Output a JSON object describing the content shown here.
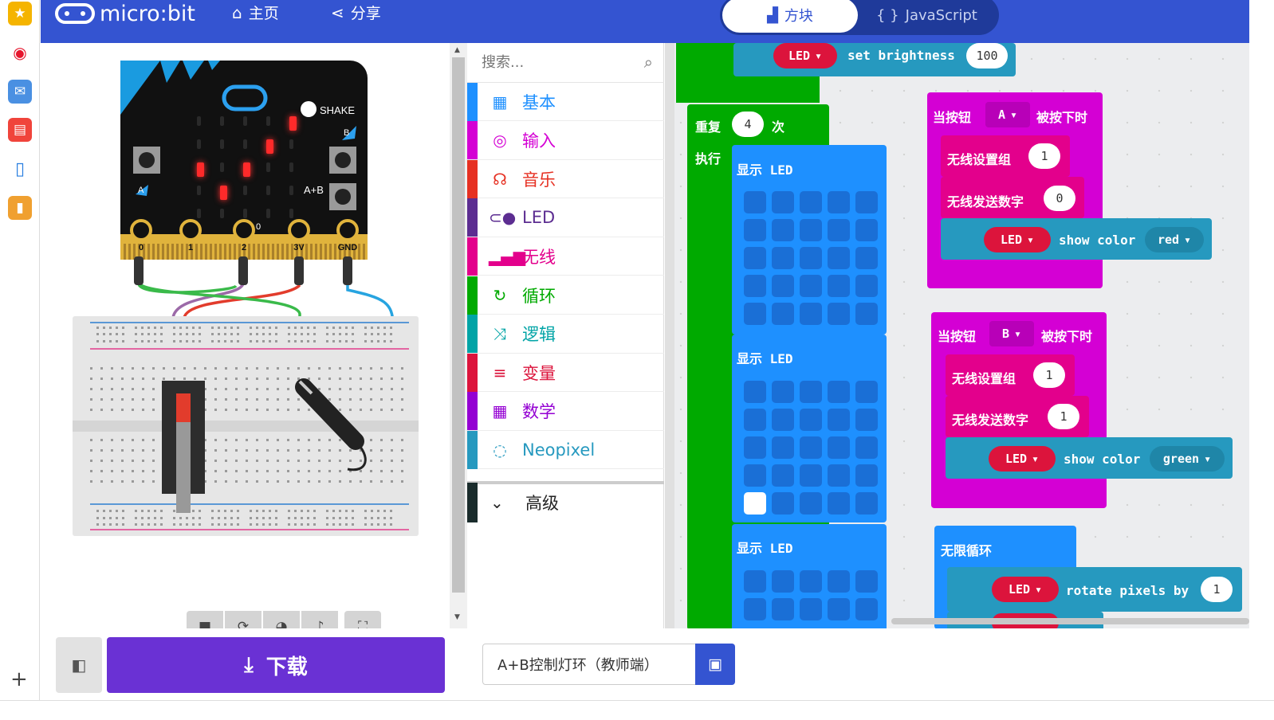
{
  "header": {
    "logo_text": "micro:bit",
    "home_label": "主页",
    "share_label": "分享",
    "mode_blocks_label": "方块",
    "mode_js_label": "JavaScript"
  },
  "simulator": {
    "board": {
      "shake_label": "SHAKE",
      "button_b_label": "B",
      "button_a_label": "A",
      "ab_label": "A+B",
      "pin_labels": [
        "0",
        "1",
        "2",
        "3V",
        "GND"
      ],
      "pin0_side_label": "0",
      "led_on": [
        [
          0,
          4,
          0
        ],
        [
          1,
          3,
          0
        ],
        [
          2,
          0,
          0
        ],
        [
          2,
          2,
          0
        ],
        [
          3,
          1,
          0
        ]
      ]
    }
  },
  "toolbox": {
    "search_placeholder": "搜索...",
    "categories": [
      {
        "label": "基本",
        "color": "#1e90ff",
        "icon": "grid-icon"
      },
      {
        "label": "输入",
        "color": "#d400d4",
        "icon": "target-icon"
      },
      {
        "label": "音乐",
        "color": "#e63022",
        "icon": "headphones-icon"
      },
      {
        "label": "LED",
        "color": "#5c2d91",
        "icon": "toggle-icon"
      },
      {
        "label": "无线",
        "color": "#e3008c",
        "icon": "signal-icon"
      },
      {
        "label": "循环",
        "color": "#00aa00",
        "icon": "loop-icon"
      },
      {
        "label": "逻辑",
        "color": "#00a4a6",
        "icon": "shuffle-icon"
      },
      {
        "label": "变量",
        "color": "#dc143c",
        "icon": "lines-icon"
      },
      {
        "label": "数学",
        "color": "#9400d3",
        "icon": "calculator-icon"
      },
      {
        "label": "Neopixel",
        "color": "#2699bf",
        "icon": "ring-icon"
      }
    ],
    "advanced_label": "高级"
  },
  "workspace": {
    "brightness_block": {
      "led": "LED",
      "text": "set brightness",
      "value": "100"
    },
    "repeat_block": {
      "repeat": "重复",
      "count": "4",
      "times": "次",
      "do": "执行"
    },
    "show_led_label": "显示",
    "show_led_suffix": "LED",
    "button_a_block": {
      "when": "当按钮",
      "button": "A",
      "pressed": "被按下时",
      "set_group": "无线设置组",
      "group": "1",
      "send_number": "无线发送数字",
      "number": "0",
      "led": "LED",
      "show_color": "show color",
      "color": "red"
    },
    "button_b_block": {
      "when": "当按钮",
      "button": "B",
      "pressed": "被按下时",
      "set_group": "无线设置组",
      "group": "1",
      "send_number": "无线发送数字",
      "number": "1",
      "led": "LED",
      "show_color": "show color",
      "color": "green"
    },
    "forever_block": {
      "label": "无限循环",
      "led": "LED",
      "rotate": "rotate pixels by",
      "value": "1"
    }
  },
  "bottom": {
    "download_label": "下载",
    "project_name": "A+B控制灯环（教师端）"
  },
  "colors": {
    "header": "#3454d1",
    "download": "#6a31d4",
    "loops": "#00aa00",
    "basic": "#1e90ff",
    "input": "#d400d4",
    "led": "#dc143c",
    "neopixel": "#2699bf"
  }
}
